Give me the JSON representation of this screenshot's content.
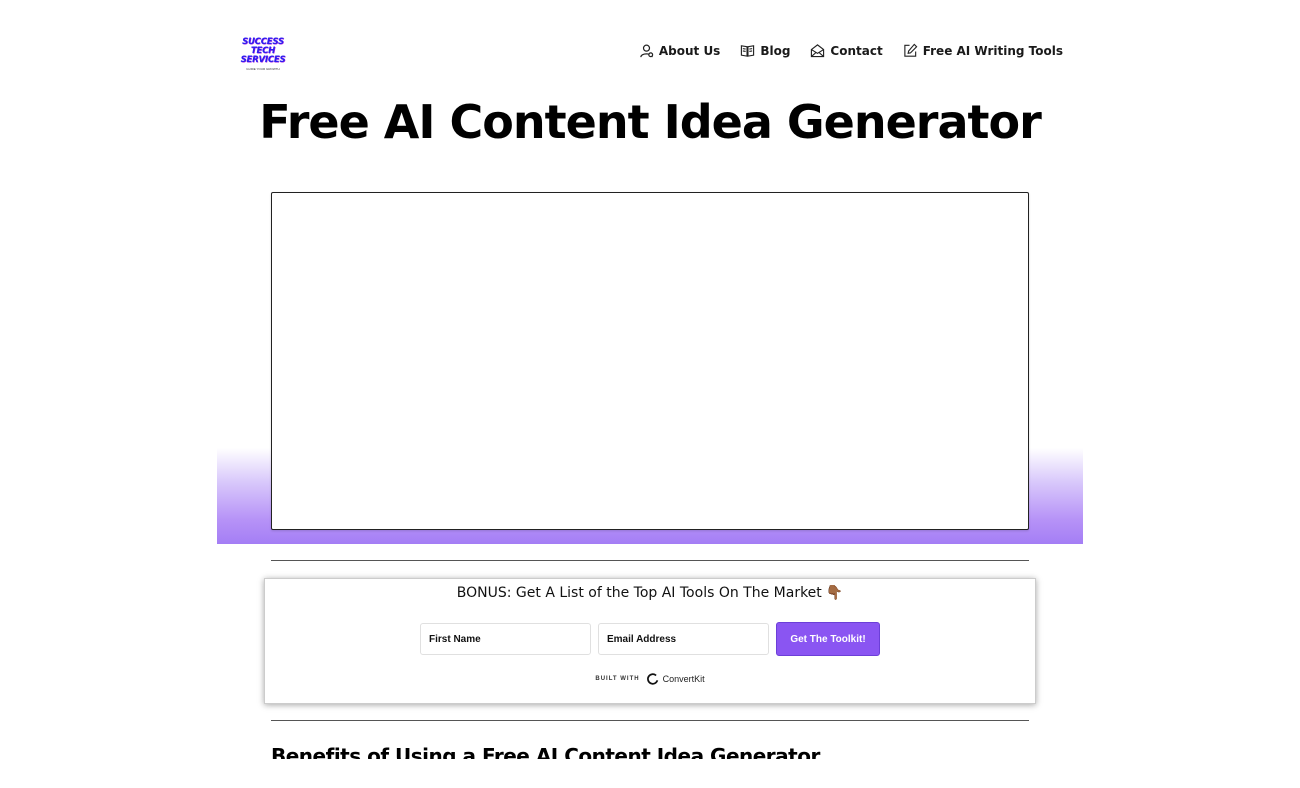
{
  "header": {
    "logo": {
      "lines": [
        "SUCCESS",
        "TECH",
        "SERVICES"
      ],
      "tagline": "GUIDE YOUR GROWTH"
    },
    "nav": [
      {
        "label": "About Us",
        "icon": "user-icon"
      },
      {
        "label": "Blog",
        "icon": "book-icon"
      },
      {
        "label": "Contact",
        "icon": "envelope-open-icon"
      },
      {
        "label": "Free AI Writing Tools",
        "icon": "pencil-square-icon"
      }
    ]
  },
  "main": {
    "title": "Free AI Content Idea Generator"
  },
  "bonus": {
    "heading": "BONUS: Get A List of the Top AI Tools On The Market",
    "emoji": "👇🏾",
    "first_name_placeholder": "First Name",
    "email_placeholder": "Email Address",
    "submit_label": "Get The Toolkit!",
    "built_with_label": "BUILT WITH",
    "provider_name": "ConvertKit"
  },
  "section": {
    "heading": "Benefits of Using a Free AI Content Idea Generator"
  },
  "colors": {
    "accent": "#8a55f2",
    "gradient_bottom": "#a47ef5",
    "logo_blue": "#2a1ff0"
  }
}
